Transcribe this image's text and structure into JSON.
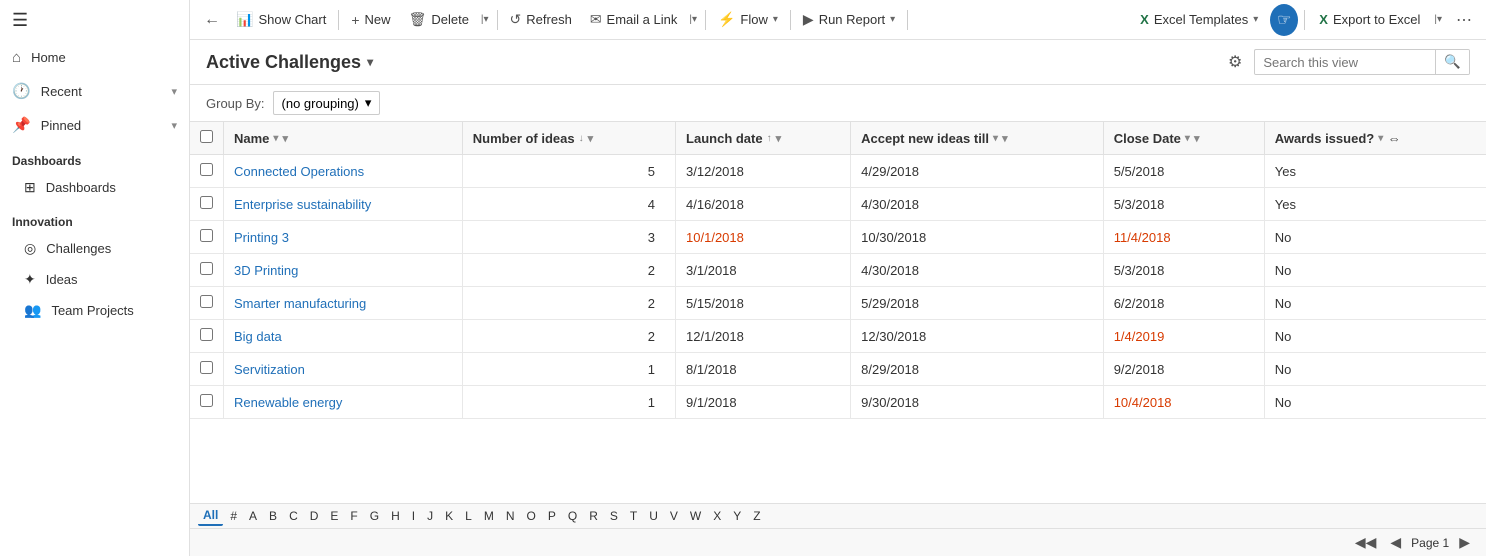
{
  "sidebar": {
    "hamburger": "☰",
    "nav": [
      {
        "id": "home",
        "icon": "⌂",
        "label": "Home",
        "chevron": false
      },
      {
        "id": "recent",
        "icon": "🕐",
        "label": "Recent",
        "chevron": true
      },
      {
        "id": "pinned",
        "icon": "📌",
        "label": "Pinned",
        "chevron": true
      }
    ],
    "sections": [
      {
        "header": "Dashboards",
        "items": [
          {
            "id": "dashboards",
            "icon": "⊞",
            "label": "Dashboards"
          }
        ]
      },
      {
        "header": "Innovation",
        "items": [
          {
            "id": "challenges",
            "icon": "◎",
            "label": "Challenges"
          },
          {
            "id": "ideas",
            "icon": "✦",
            "label": "Ideas"
          },
          {
            "id": "team-projects",
            "icon": "👥",
            "label": "Team Projects"
          }
        ]
      }
    ]
  },
  "toolbar": {
    "back_icon": "←",
    "show_chart_label": "Show Chart",
    "show_chart_icon": "📊",
    "new_label": "New",
    "new_icon": "+",
    "delete_label": "Delete",
    "delete_icon": "🗑",
    "more_dropdown_icon": "▾",
    "refresh_label": "Refresh",
    "refresh_icon": "↺",
    "email_link_label": "Email a Link",
    "email_link_icon": "✉",
    "flow_label": "Flow",
    "flow_icon": "⚡",
    "run_report_label": "Run Report",
    "run_report_icon": "▶",
    "excel_templates_label": "Excel Templates",
    "excel_templates_icon": "📋",
    "export_excel_label": "Export to Excel",
    "export_excel_icon": "X",
    "more_icon": "⋯"
  },
  "view_header": {
    "title": "Active Challenges",
    "title_chevron": "▾",
    "search_placeholder": "Search this view",
    "search_icon": "🔍",
    "filter_icon": "⚙"
  },
  "group_by": {
    "label": "Group By:",
    "value": "(no grouping)",
    "arrow": "▾"
  },
  "columns": [
    {
      "id": "name",
      "label": "Name",
      "sort": "▾",
      "filter": true
    },
    {
      "id": "num_ideas",
      "label": "Number of ideas",
      "sort": "↓",
      "filter": true
    },
    {
      "id": "launch_date",
      "label": "Launch date",
      "sort": "↑",
      "filter": true
    },
    {
      "id": "accept_ideas",
      "label": "Accept new ideas till",
      "sort": "▾",
      "filter": true
    },
    {
      "id": "close_date",
      "label": "Close Date",
      "sort": "▾",
      "filter": true
    },
    {
      "id": "awards",
      "label": "Awards issued?",
      "sort": "▾",
      "filter": false
    }
  ],
  "rows": [
    {
      "name": "Connected Operations",
      "num_ideas": 5,
      "launch_date": "3/12/2018",
      "launch_date_orange": false,
      "accept_ideas": "4/29/2018",
      "accept_orange": false,
      "close_date": "5/5/2018",
      "close_orange": false,
      "awards": "Yes"
    },
    {
      "name": "Enterprise sustainability",
      "num_ideas": 4,
      "launch_date": "4/16/2018",
      "launch_date_orange": false,
      "accept_ideas": "4/30/2018",
      "accept_orange": false,
      "close_date": "5/3/2018",
      "close_orange": false,
      "awards": "Yes"
    },
    {
      "name": "Printing 3",
      "num_ideas": 3,
      "launch_date": "10/1/2018",
      "launch_date_orange": true,
      "accept_ideas": "10/30/2018",
      "accept_orange": false,
      "close_date": "11/4/2018",
      "close_orange": true,
      "awards": "No"
    },
    {
      "name": "3D Printing",
      "num_ideas": 2,
      "launch_date": "3/1/2018",
      "launch_date_orange": false,
      "accept_ideas": "4/30/2018",
      "accept_orange": false,
      "close_date": "5/3/2018",
      "close_orange": false,
      "awards": "No"
    },
    {
      "name": "Smarter manufacturing",
      "num_ideas": 2,
      "launch_date": "5/15/2018",
      "launch_date_orange": false,
      "accept_ideas": "5/29/2018",
      "accept_orange": false,
      "close_date": "6/2/2018",
      "close_orange": false,
      "awards": "No"
    },
    {
      "name": "Big data",
      "num_ideas": 2,
      "launch_date": "12/1/2018",
      "launch_date_orange": false,
      "accept_ideas": "12/30/2018",
      "accept_orange": false,
      "close_date": "1/4/2019",
      "close_orange": true,
      "awards": "No"
    },
    {
      "name": "Servitization",
      "num_ideas": 1,
      "launch_date": "8/1/2018",
      "launch_date_orange": false,
      "accept_ideas": "8/29/2018",
      "accept_orange": false,
      "close_date": "9/2/2018",
      "close_orange": false,
      "awards": "No"
    },
    {
      "name": "Renewable energy",
      "num_ideas": 1,
      "launch_date": "9/1/2018",
      "launch_date_orange": false,
      "accept_ideas": "9/30/2018",
      "accept_orange": false,
      "close_date": "10/4/2018",
      "close_orange": true,
      "awards": "No"
    }
  ],
  "alpha_bar": [
    "All",
    "#",
    "A",
    "B",
    "C",
    "D",
    "E",
    "F",
    "G",
    "H",
    "I",
    "J",
    "K",
    "L",
    "M",
    "N",
    "O",
    "P",
    "Q",
    "R",
    "S",
    "T",
    "U",
    "V",
    "W",
    "X",
    "Y",
    "Z"
  ],
  "pagination": {
    "first_icon": "◀◀",
    "prev_icon": "◀",
    "page_label": "Page 1",
    "next_icon": "▶"
  }
}
